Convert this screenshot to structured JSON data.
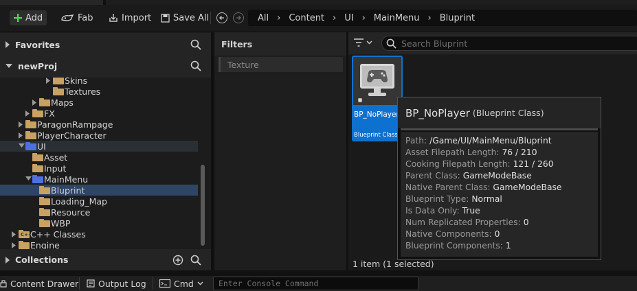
{
  "toolbar": {
    "add_label": "Add",
    "fab_label": "Fab",
    "import_label": "Import",
    "save_all_label": "Save All"
  },
  "breadcrumb": [
    "All",
    "Content",
    "UI",
    "MainMenu",
    "Bluprint"
  ],
  "sidebar": {
    "favorites_label": "Favorites",
    "project_label": "newProj",
    "collections_label": "Collections",
    "tree": [
      {
        "label": "Skins"
      },
      {
        "label": "Textures"
      },
      {
        "label": "Maps"
      },
      {
        "label": "FX"
      },
      {
        "label": "ParagonRampage"
      },
      {
        "label": "PlayerCharacter"
      },
      {
        "label": "UI"
      },
      {
        "label": "Asset"
      },
      {
        "label": "Input"
      },
      {
        "label": "MainMenu"
      },
      {
        "label": "Bluprint"
      },
      {
        "label": "Loading_Map"
      },
      {
        "label": "Resource"
      },
      {
        "label": "WBP"
      },
      {
        "label": "C++ Classes"
      },
      {
        "label": "Engine"
      }
    ]
  },
  "filters": {
    "title": "Filters",
    "items": [
      "Texture"
    ]
  },
  "content": {
    "search_placeholder": "Search Bluprint",
    "asset": {
      "name": "BP_NoPlayer",
      "type": "Blueprint Class"
    },
    "status": "1 item (1 selected)"
  },
  "tooltip": {
    "title": "BP_NoPlayer",
    "subtitle": "(Blueprint Class)",
    "rows": [
      {
        "key": "Path:",
        "value": "/Game/UI/MainMenu/Bluprint"
      },
      {
        "key": "Asset Filepath Length:",
        "value": "76 / 210"
      },
      {
        "key": "Cooking Filepath Length:",
        "value": "121 / 260"
      },
      {
        "key": "Parent Class:",
        "value": "GameModeBase"
      },
      {
        "key": "Native Parent Class:",
        "value": "GameModeBase"
      },
      {
        "key": "Blueprint Type:",
        "value": "Normal"
      },
      {
        "key": "Is Data Only:",
        "value": "True"
      },
      {
        "key": "Num Replicated Properties:",
        "value": "0"
      },
      {
        "key": "Native Components:",
        "value": "0"
      },
      {
        "key": "Blueprint Components:",
        "value": "1"
      }
    ]
  },
  "bottombar": {
    "content_drawer_label": "Content Drawer",
    "output_log_label": "Output Log",
    "cmd_label": "Cmd",
    "console_placeholder": "Enter Console Command"
  },
  "colors": {
    "accent_blue": "#0f71cf",
    "selection": "#2f4566",
    "folder": "#c9a163",
    "folder_open": "#4f6fe0",
    "add_plus": "#4fcf4f"
  }
}
